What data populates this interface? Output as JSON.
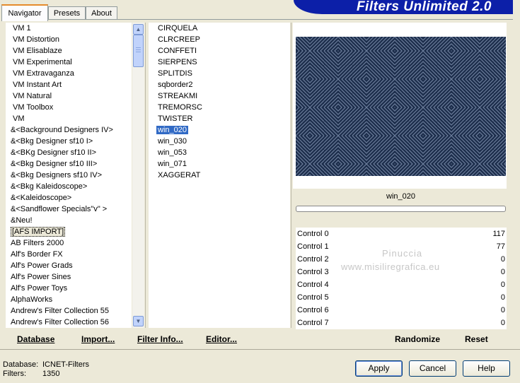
{
  "tabs": [
    "Navigator",
    "Presets",
    "About"
  ],
  "title": "Filters Unlimited 2.0",
  "categories": [
    "VM 1",
    "VM Distortion",
    "VM Elisablaze",
    "VM Experimental",
    "VM Extravaganza",
    "VM Instant Art",
    "VM Natural",
    "VM Toolbox",
    "VM",
    "&<Background Designers IV>",
    "&<Bkg Designer sf10 I>",
    "&<BKg Designer sf10 II>",
    "&<Bkg Designer sf10 III>",
    "&<Bkg Designers sf10 IV>",
    "&<Bkg Kaleidoscope>",
    "&<Kaleidoscope>",
    "&<Sandflower Specials\"v\" >",
    "&Neu!",
    "[AFS IMPORT]",
    "AB Filters 2000",
    "Alf's Border FX",
    "Alf's Power Grads",
    "Alf's Power Sines",
    "Alf's Power Toys",
    "AlphaWorks",
    "Andrew's Filter Collection 55",
    "Andrew's Filter Collection 56"
  ],
  "filters": [
    "CIRQUELA",
    "CLRCREEP",
    "CONFFETI",
    "SIERPENS",
    "SPLITDIS",
    "sqborder2",
    "STREAKMI",
    "TREMORSC",
    "TWISTER",
    "win_020",
    "win_030",
    "win_053",
    "win_071",
    "XAGGERAT"
  ],
  "selected_filter": "win_020",
  "preview_filter_name": "win_020",
  "controls": [
    {
      "label": "Control 0",
      "value": "117"
    },
    {
      "label": "Control 1",
      "value": "77"
    },
    {
      "label": "Control 2",
      "value": "0"
    },
    {
      "label": "Control 3",
      "value": "0"
    },
    {
      "label": "Control 4",
      "value": "0"
    },
    {
      "label": "Control 5",
      "value": "0"
    },
    {
      "label": "Control 6",
      "value": "0"
    },
    {
      "label": "Control 7",
      "value": "0"
    }
  ],
  "watermark": {
    "line1": "Pinuccia",
    "line2": "www.misiliregrafica.eu"
  },
  "toolbar": {
    "database": "Database",
    "import": "Import...",
    "filter_info": "Filter Info...",
    "editor": "Editor...",
    "randomize": "Randomize",
    "reset": "Reset"
  },
  "info": {
    "database_label": "Database:",
    "database_value": "ICNET-Filters",
    "filters_label": "Filters:",
    "filters_value": "1350"
  },
  "buttons": {
    "apply": "Apply",
    "cancel": "Cancel",
    "help": "Help"
  },
  "colors": {
    "selection": "#316ac5",
    "banner": "#0c1fa8",
    "accent_tab": "#e68b2c"
  }
}
